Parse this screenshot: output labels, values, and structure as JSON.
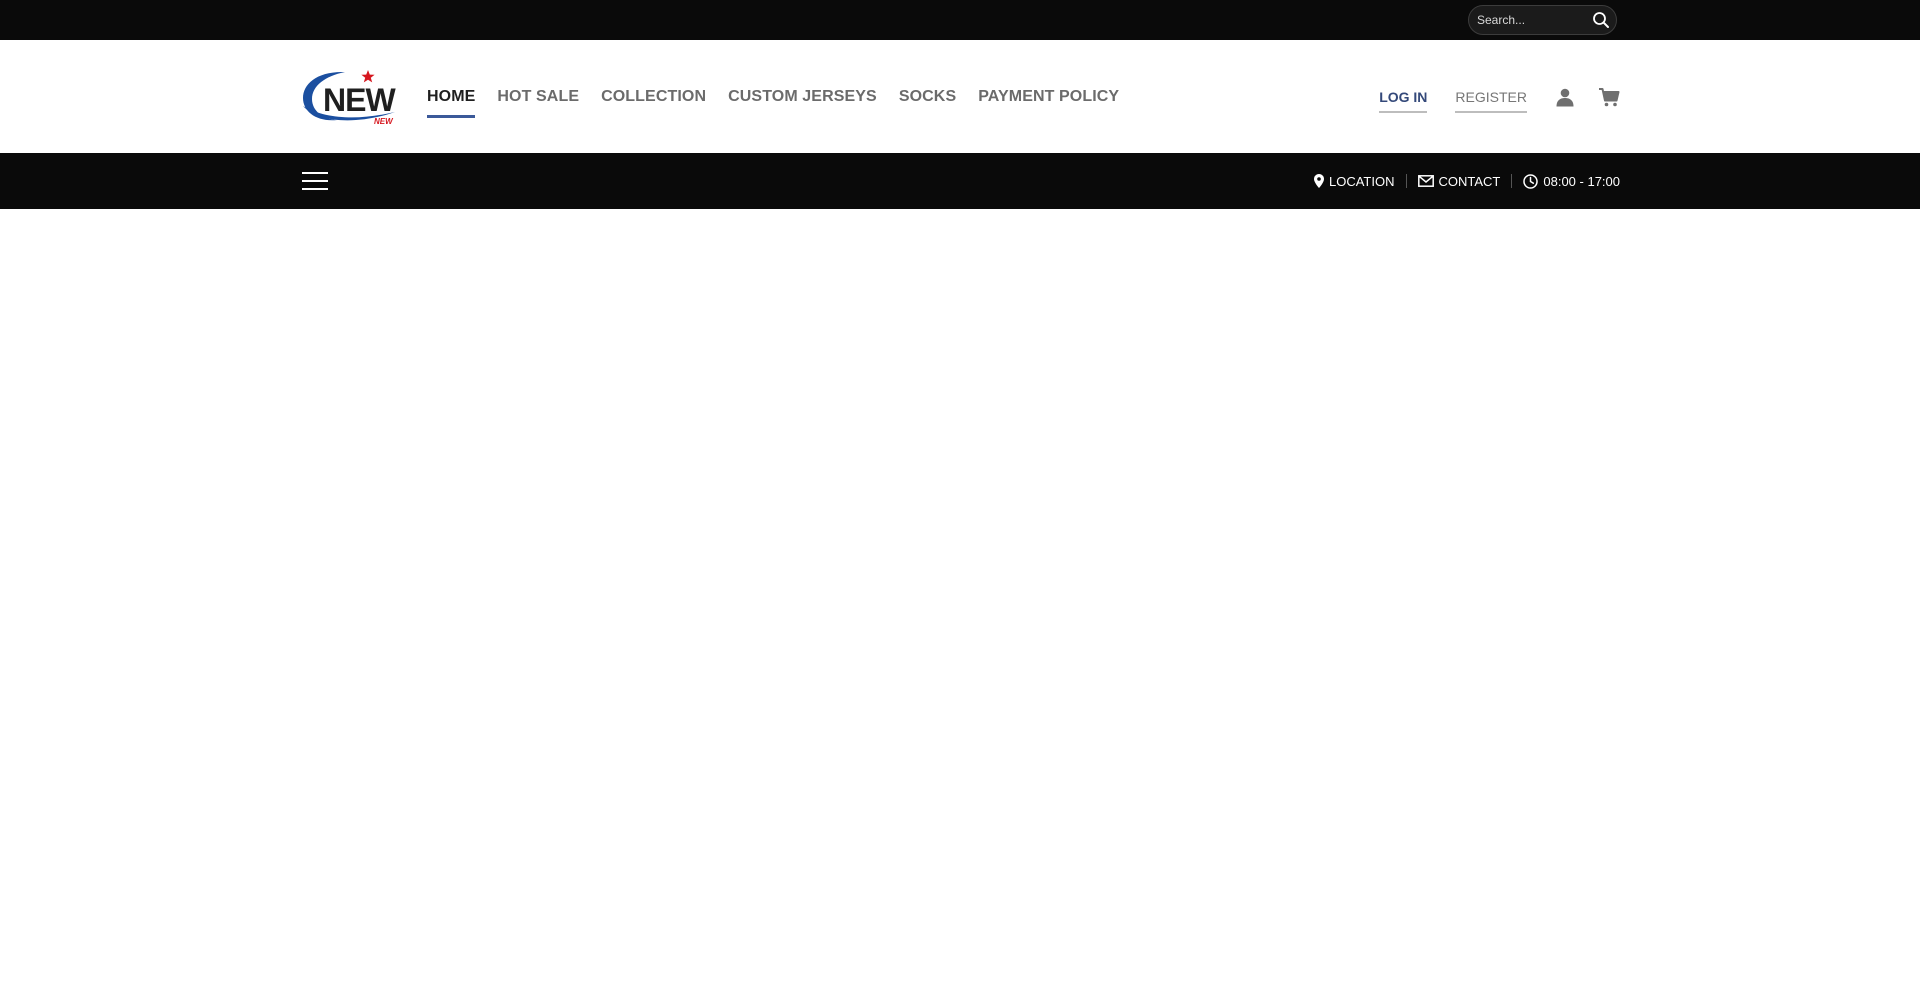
{
  "topbar": {
    "search_placeholder": "Search..."
  },
  "header": {
    "logo": {
      "main_text": "NEW",
      "sub_text": "NEW",
      "brand_blue": "#1b4fa0",
      "brand_red": "#d6171f"
    },
    "nav": [
      {
        "label": "HOME",
        "active": true
      },
      {
        "label": "HOT SALE",
        "active": false
      },
      {
        "label": "COLLECTION",
        "active": false
      },
      {
        "label": "CUSTOM JERSEYS",
        "active": false
      },
      {
        "label": "SOCKS",
        "active": false
      },
      {
        "label": "PAYMENT POLICY",
        "active": false
      }
    ],
    "account": {
      "login_label": "LOG IN",
      "register_label": "REGISTER",
      "user_icon": "user-icon",
      "cart_icon": "cart-icon"
    }
  },
  "subbar": {
    "menu_icon": "menu-icon",
    "info": {
      "location_label": "LOCATION",
      "contact_label": "CONTACT",
      "hours_label": "08:00 - 17:00"
    }
  },
  "colors": {
    "dark_bar": "#0a0a0a",
    "accent": "#3b5999",
    "nav_text": "#6b6b6b"
  }
}
